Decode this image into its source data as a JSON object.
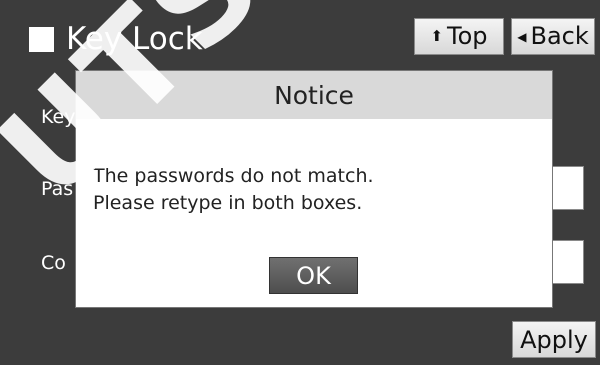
{
  "header": {
    "title": "Key Lock",
    "top_label": "Top",
    "back_label": "Back",
    "icons": {
      "title": "square-icon",
      "top": "arrow-up-icon",
      "back": "arrow-left-icon"
    }
  },
  "form": {
    "key_label": "Key",
    "password_label": "Pas",
    "confirm_label": "Co",
    "apply_label": "Apply"
  },
  "dialog": {
    "title": "Notice",
    "line1": "The passwords do not match.",
    "line2": "Please retype in both boxes.",
    "ok_label": "OK"
  },
  "watermark": {
    "text": "UTSCH"
  },
  "colors": {
    "background": "#3c3c3c",
    "dialog_header": "#d9d9d9",
    "ok_button": "#5e5e5e"
  }
}
